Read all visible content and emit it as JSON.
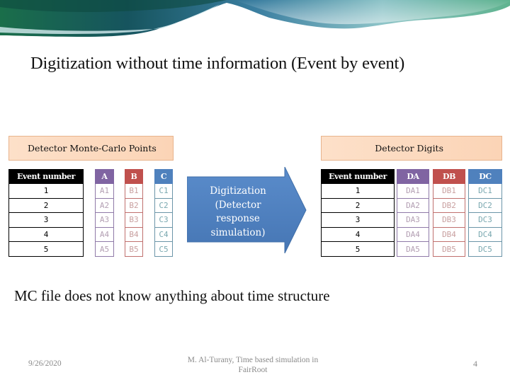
{
  "slide": {
    "title": "Digitization without time information (Event by event)",
    "note": "MC file does not know anything about time structure"
  },
  "left_panel": {
    "label": "Detector Monte-Carlo Points",
    "table": {
      "headers": [
        "Event number",
        "A",
        "B",
        "C"
      ],
      "rows": [
        [
          "1",
          "A1",
          "B1",
          "C1"
        ],
        [
          "2",
          "A2",
          "B2",
          "C2"
        ],
        [
          "3",
          "A3",
          "B3",
          "C3"
        ],
        [
          "4",
          "A4",
          "B4",
          "C4"
        ],
        [
          "5",
          "A5",
          "B5",
          "C5"
        ]
      ]
    }
  },
  "arrow": {
    "lines": [
      "Digitization",
      "(Detector",
      "response",
      "simulation)"
    ],
    "color": "#4f81bd"
  },
  "right_panel": {
    "label": "Detector Digits",
    "table": {
      "headers": [
        "Event number",
        "DA",
        "DB",
        "DC"
      ],
      "rows": [
        [
          "1",
          "DA1",
          "DB1",
          "DC1"
        ],
        [
          "2",
          "DA2",
          "DB2",
          "DC2"
        ],
        [
          "3",
          "DA3",
          "DB3",
          "DC3"
        ],
        [
          "4",
          "DA4",
          "DB4",
          "DC4"
        ],
        [
          "5",
          "DA5",
          "DB5",
          "DC5"
        ]
      ]
    }
  },
  "footer": {
    "date": "9/26/2020",
    "center_line1": "M. Al-Turany, Time based simulation in",
    "center_line2": "FairRoot",
    "page": "4"
  },
  "colors": {
    "col_a": "#8064a2",
    "col_b": "#c0504d",
    "col_c": "#4f81bd",
    "label_box": "#fbd4b6"
  }
}
